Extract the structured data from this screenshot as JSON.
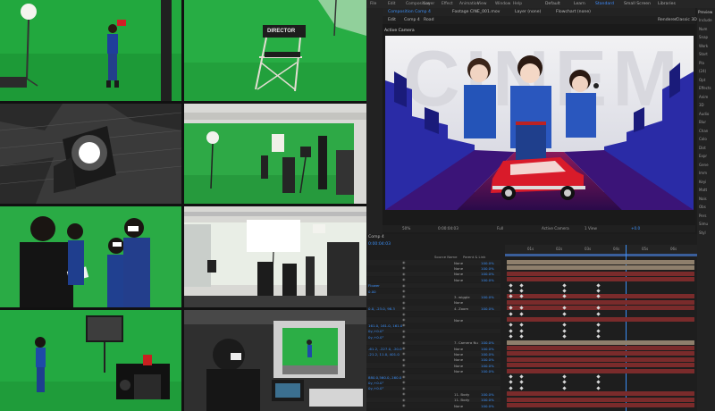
{
  "colors": {
    "greenscreen": "#1fa43a",
    "ae_bg": "#1c1c1c",
    "accent": "#3b8ef5",
    "track_red": "#7a2b2b",
    "track_tan": "#8e7f6c"
  },
  "ae": {
    "menu": [
      "File",
      "Edit",
      "Composition",
      "Layer",
      "Effect",
      "Animation",
      "View",
      "Window",
      "Help"
    ],
    "workspaces": [
      "Default",
      "Learn",
      "Standard",
      "Small Screen",
      "Libraries"
    ],
    "workspace_active": "Standard",
    "panel_tabs": [
      "Composition Comp 4",
      "Footage CINE_001.mov",
      "Layer (none)",
      "Flowchart (none)"
    ],
    "comp_tabs": [
      "Edit",
      "Comp 4",
      "Road"
    ],
    "renderer_label": "Renderer:",
    "renderer_value": "Classic 3D",
    "active_camera_label": "Active Camera",
    "viewer_footer": [
      "50%",
      "0:00:04:03",
      "Full",
      "Active Camera",
      "1 View",
      "+0.0"
    ],
    "artwork_text": "CINEMA",
    "timeline_tab": "Comp 4",
    "timecode": "0:00:04:03",
    "layer_header": [
      "Source Name",
      "Parent & Link"
    ],
    "ruler_labels": [
      "01s",
      "02s",
      "03s",
      "04s",
      "05s",
      "06s"
    ],
    "right_panel": {
      "title": "Preview",
      "items": [
        "Include",
        "Num",
        "Snap",
        "Work",
        "Start",
        "Pla",
        "(24)",
        "Opt",
        "Effects",
        "Anim",
        "3D",
        "Audio",
        "Blur",
        "Chan",
        "Colo",
        "Dist",
        "Expr",
        "Gene",
        "Imm",
        "Keyi",
        "Matt",
        "Nois",
        "Obs",
        "Pers",
        "Simu",
        "Styl"
      ]
    },
    "layers": [
      {
        "name": "",
        "parent": "None",
        "value": "100.0%"
      },
      {
        "name": "",
        "parent": "None",
        "value": "100.0%"
      },
      {
        "name": "",
        "parent": "None",
        "value": "100.0%"
      },
      {
        "name": "",
        "parent": "None",
        "value": "100.0%"
      },
      {
        "name": "Flower",
        "parent": "",
        "value": ""
      },
      {
        "name": "0.00",
        "parent": "",
        "value": ""
      },
      {
        "name": "",
        "parent": "3. wiggle",
        "value": "100.0%"
      },
      {
        "name": "",
        "parent": "None",
        "value": ""
      },
      {
        "name": "0.0, -23.0, 98.3",
        "parent": "4. Zoom",
        "value": "100.0%"
      },
      {
        "name": "",
        "parent": "",
        "value": ""
      },
      {
        "name": "",
        "parent": "None",
        "value": ""
      },
      {
        "name": "161.0, 161.0, 161.0",
        "parent": "",
        "value": ""
      },
      {
        "name": "0y,+0.0°",
        "parent": "",
        "value": ""
      },
      {
        "name": "0y,+0.0°",
        "parent": "",
        "value": ""
      },
      {
        "name": "",
        "parent": "7. Camera Nu",
        "value": "100.0%"
      },
      {
        "name": "-61.2, -227.0, -20.0",
        "parent": "None",
        "value": "100.0%"
      },
      {
        "name": "-21.2, 11.0, 401.0",
        "parent": "None",
        "value": "100.0%"
      },
      {
        "name": "",
        "parent": "None",
        "value": "100.0%"
      },
      {
        "name": "",
        "parent": "None",
        "value": "100.0%"
      },
      {
        "name": "",
        "parent": "None",
        "value": "100.0%"
      },
      {
        "name": "880.0,560.0,-160.0",
        "parent": "",
        "value": ""
      },
      {
        "name": "0y,+0.0°",
        "parent": "",
        "value": ""
      },
      {
        "name": "0y,+0.0°",
        "parent": "",
        "value": ""
      },
      {
        "name": "",
        "parent": "11. Body",
        "value": "100.0%"
      },
      {
        "name": "",
        "parent": "11. Body",
        "value": "100.0%"
      },
      {
        "name": "",
        "parent": "None",
        "value": "100.0%"
      }
    ]
  },
  "photos": [
    {
      "label": "DIRECTOR"
    }
  ]
}
